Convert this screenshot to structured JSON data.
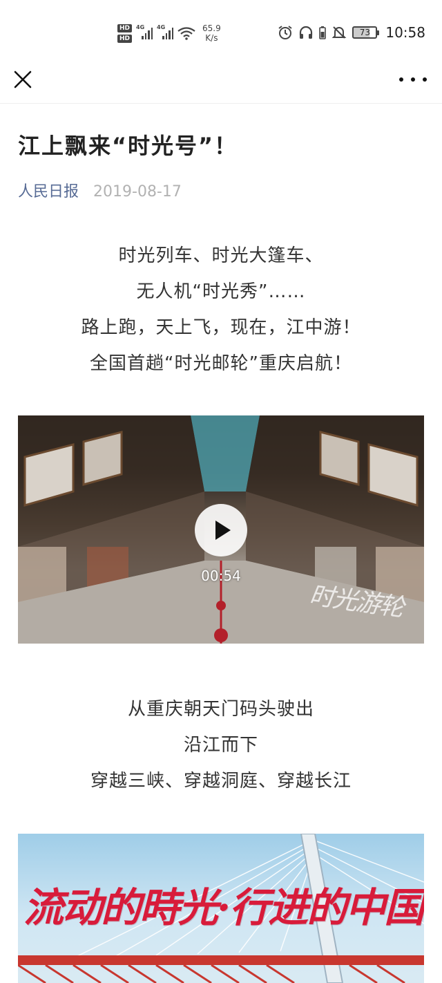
{
  "status_bar": {
    "hd1": "HD",
    "hd2": "HD",
    "signal1": "4G",
    "signal2": "4G",
    "speed_value": "65.9",
    "speed_unit": "K/s",
    "battery": "73",
    "time": "10:58"
  },
  "navbar": {
    "icons": [
      "close-icon",
      "more-icon"
    ]
  },
  "article": {
    "title": "江上飘来“时光号”！",
    "author": "人民日报",
    "date": "2019-08-17",
    "intro_lines": [
      "时光列车、时光大篷车、",
      "无人机“时光秀”……",
      "路上跑，天上飞，现在，江中游！",
      "全国首趟“时光邮轮”重庆启航！"
    ],
    "video": {
      "duration": "00:54",
      "watermark": "时光游轮"
    },
    "body_lines": [
      "从重庆朝天门码头驶出",
      "沿江而下",
      "穿越三峡、穿越洞庭、穿越长江"
    ],
    "banner_text": "流动的時光·行进的中国"
  }
}
